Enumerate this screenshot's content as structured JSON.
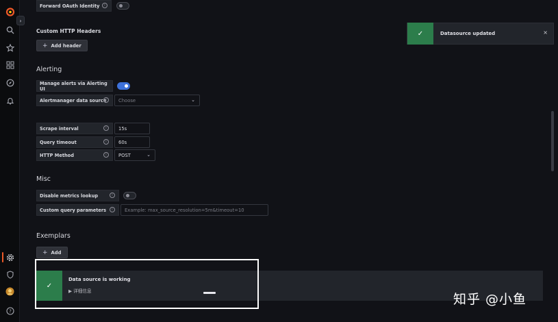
{
  "sidebar": {
    "icons": [
      "grafana-logo-icon",
      "search-icon",
      "star-icon",
      "dashboards-icon",
      "explore-icon",
      "alert-bell-icon",
      "gear-icon",
      "shield-icon",
      "user-avatar-icon",
      "help-icon"
    ],
    "toggle_glyph": "›",
    "active_item": "configuration",
    "accent_color": "#f05a28"
  },
  "auth": {
    "forward_oauth_label": "Forward OAuth Identity",
    "forward_oauth_enabled": false
  },
  "custom_headers": {
    "title": "Custom HTTP Headers",
    "add_button": "Add header"
  },
  "alerting": {
    "title": "Alerting",
    "manage_alerts_label": "Manage alerts via Alerting UI",
    "manage_alerts_enabled": true,
    "alertmanager_label": "Alertmanager data source",
    "alertmanager_value": "Choose"
  },
  "http_settings": {
    "scrape_interval_label": "Scrape interval",
    "scrape_interval_value": "15s",
    "query_timeout_label": "Query timeout",
    "query_timeout_value": "60s",
    "http_method_label": "HTTP Method",
    "http_method_value": "POST"
  },
  "misc": {
    "title": "Misc",
    "disable_metrics_label": "Disable metrics lookup",
    "disable_metrics_enabled": false,
    "custom_query_label": "Custom query parameters",
    "custom_query_placeholder": "Example: max_source_resolution=5m&timeout=10"
  },
  "exemplars": {
    "title": "Exemplars",
    "add_button": "Add"
  },
  "toast": {
    "message": "Datasource updated",
    "close_glyph": "×"
  },
  "status": {
    "title": "Data source is working",
    "details": "▶ 详细信息"
  },
  "watermark": "知乎 @小鱼",
  "colors": {
    "success": "#2c7d4b",
    "toggle_on": "#3d71d9",
    "background": "#111217",
    "panel": "#22252b"
  }
}
